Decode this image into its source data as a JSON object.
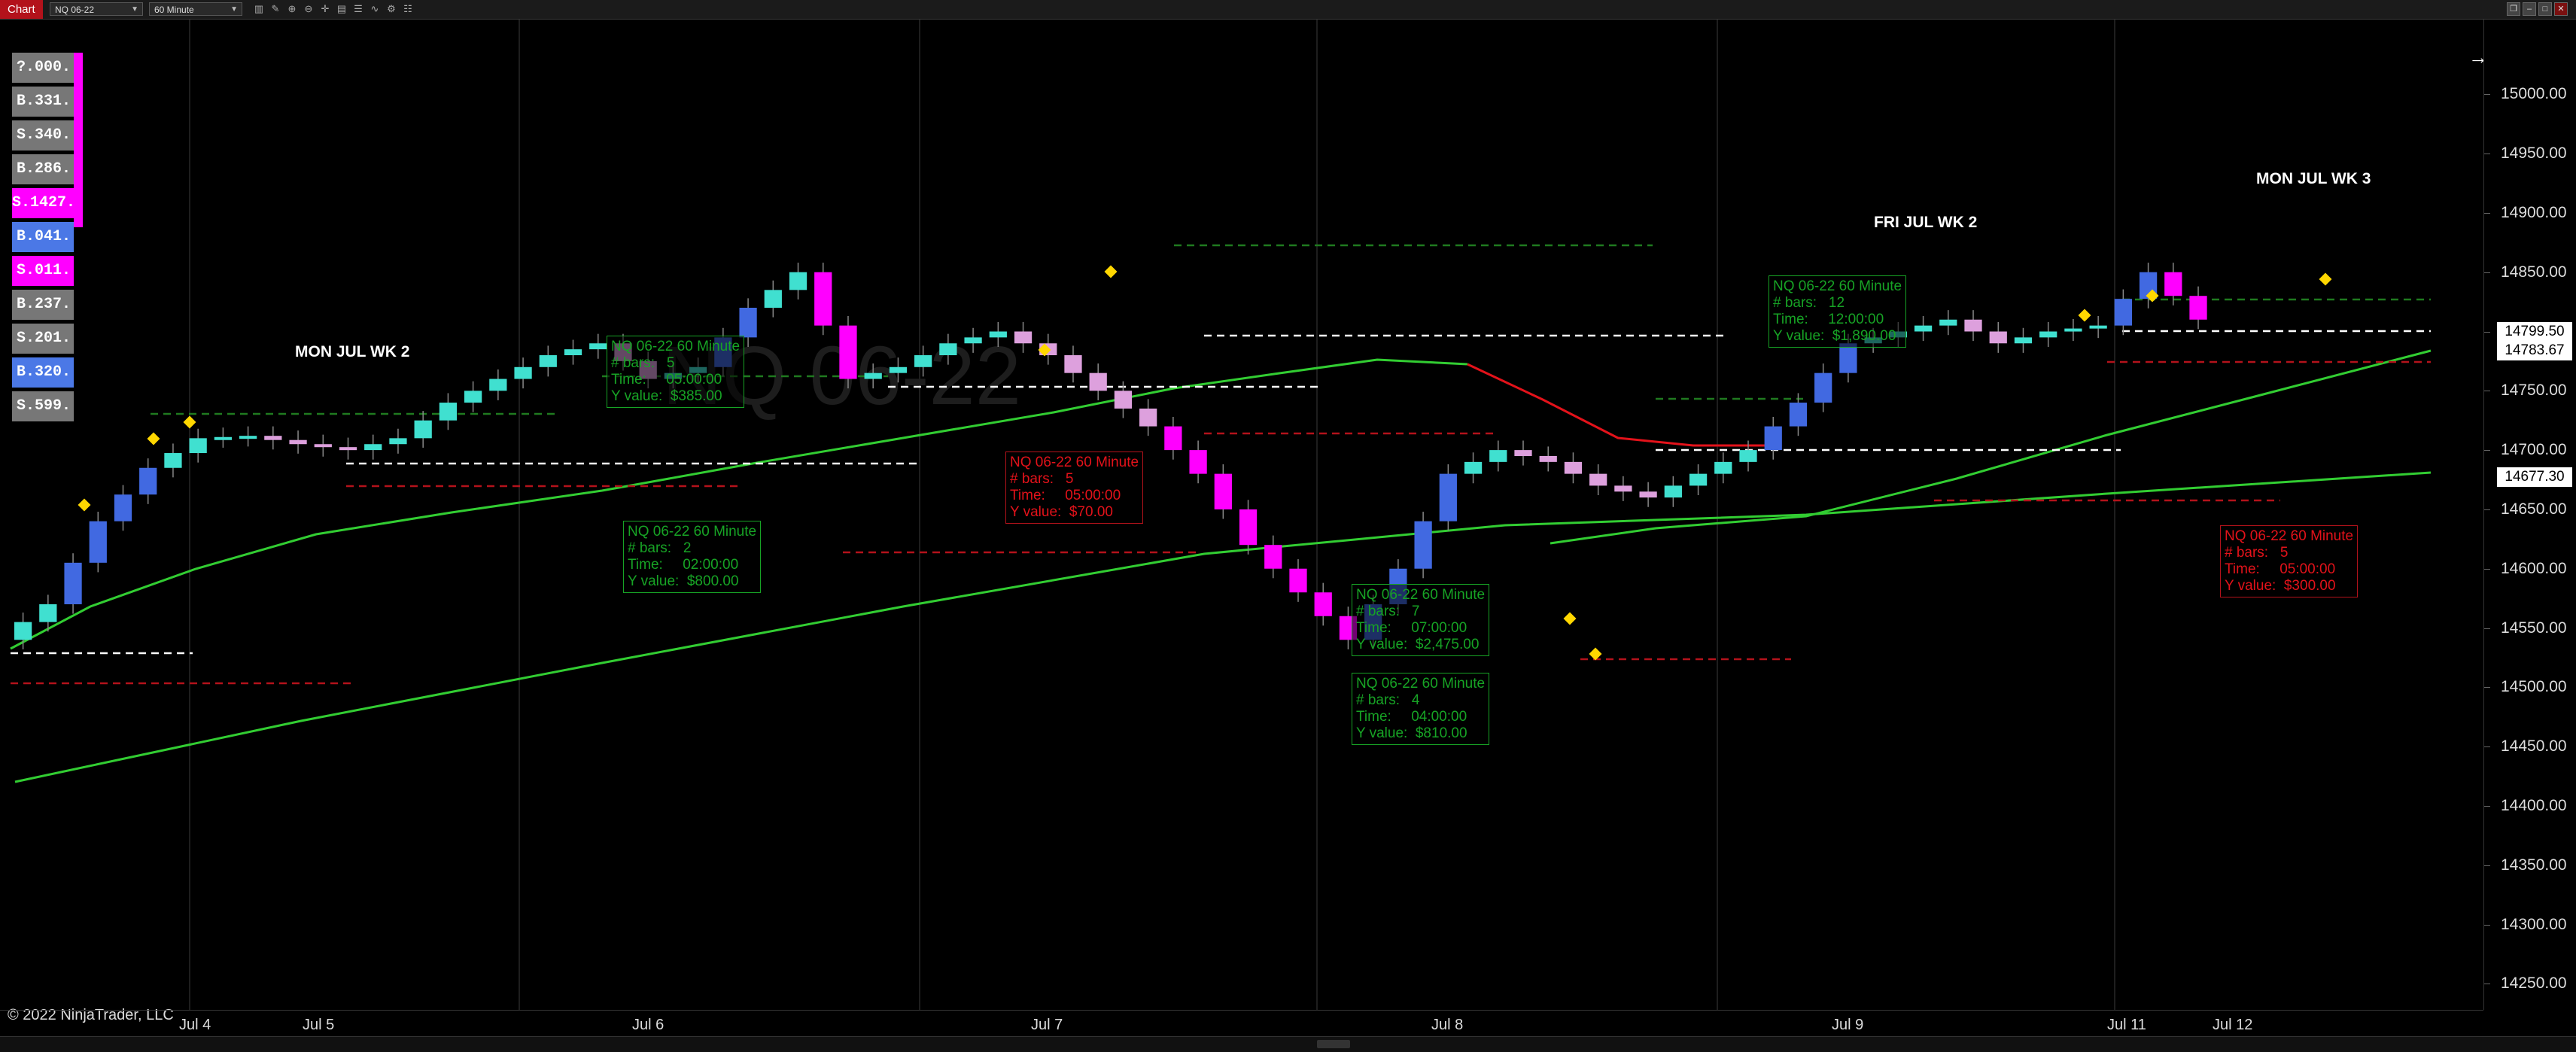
{
  "toolbar": {
    "tab_label": "Chart",
    "instrument": "NQ 06-22",
    "interval": "60 Minute",
    "icons": [
      "bar-type-icon",
      "pencil-icon",
      "zoom-in-icon",
      "zoom-out-icon",
      "crosshair-icon",
      "data-box-icon",
      "chart-properties-icon",
      "indicators-icon",
      "strategies-icon",
      "templates-icon"
    ],
    "window_buttons": [
      "restore",
      "minimize",
      "maximize",
      "close"
    ],
    "window_glyphs": [
      "❐",
      "‒",
      "□",
      "✕"
    ]
  },
  "chart": {
    "watermark": "NQ 06-22",
    "copyright": "© 2022 NinjaTrader, LLC",
    "session_labels": [
      {
        "text": "MON JUL WK 2"
      },
      {
        "text": "FRI JUL WK 2"
      },
      {
        "text": "MON JUL WK 3"
      }
    ],
    "order_tags": [
      {
        "text": "?.000.",
        "color": "#777777"
      },
      {
        "text": "B.331.",
        "color": "#777777"
      },
      {
        "text": "S.340.",
        "color": "#777777"
      },
      {
        "text": "B.286.",
        "color": "#777777"
      },
      {
        "text": "S.1427.",
        "color": "#ff00ff"
      },
      {
        "text": "B.041.",
        "color": "#4b78e6"
      },
      {
        "text": "S.011.",
        "color": "#ff00ff"
      },
      {
        "text": "B.237.",
        "color": "#777777"
      },
      {
        "text": "S.201.",
        "color": "#777777"
      },
      {
        "text": "B.320.",
        "color": "#4b78e6"
      },
      {
        "text": "S.599.",
        "color": "#777777"
      }
    ],
    "annotations": [
      {
        "title": "NQ 06-22 60 Minute",
        "bars": "5",
        "time": "05:00:00",
        "yvalue": "$385.00",
        "color": "green"
      },
      {
        "title": "NQ 06-22 60 Minute",
        "bars": "2",
        "time": "02:00:00",
        "yvalue": "$800.00",
        "color": "green"
      },
      {
        "title": "NQ 06-22 60 Minute",
        "bars": "5",
        "time": "05:00:00",
        "yvalue": "$70.00",
        "color": "red"
      },
      {
        "title": "NQ 06-22 60 Minute",
        "bars": "7",
        "time": "07:00:00",
        "yvalue": "$2,475.00",
        "color": "green"
      },
      {
        "title": "NQ 06-22 60 Minute",
        "bars": "4",
        "time": "04:00:00",
        "yvalue": "$810.00",
        "color": "green"
      },
      {
        "title": "NQ 06-22 60 Minute",
        "bars": "12",
        "time": "12:00:00",
        "yvalue": "$1,890.00",
        "color": "green"
      },
      {
        "title": "NQ 06-22 60 Minute",
        "bars": "5",
        "time": "05:00:00",
        "yvalue": "$300.00",
        "color": "red"
      }
    ],
    "annotation_labels": {
      "bars": "# bars:",
      "time": "Time:",
      "yvalue": "Y value:"
    },
    "price_flags": [
      {
        "text": "14799.50",
        "bg": "#ffffff",
        "fg": "#000000",
        "price": 14799.5
      },
      {
        "text": "14783.67",
        "bg": "#ffffff",
        "fg": "#000000",
        "price": 14783.67
      },
      {
        "text": "14677.30",
        "bg": "#ffffff",
        "fg": "#000000",
        "price": 14677.3
      }
    ],
    "colors": {
      "up_bar": "#4169e1",
      "down_bar": "#ff00ff",
      "up_small": "#40e0d0",
      "down_small": "#dda0dd",
      "ema_fast": "#32cd32",
      "ema_slow": "#32cd32",
      "ema_red": "#e3121a",
      "signal": "#ffd700"
    }
  },
  "chart_data": {
    "type": "candlestick",
    "instrument": "NQ 06-22",
    "interval": "60 Minute",
    "y_ticks": [
      "15000.00",
      "14950.00",
      "14900.00",
      "14850.00",
      "14800.00",
      "14750.00",
      "14700.00",
      "14650.00",
      "14600.00",
      "14550.00",
      "14500.00",
      "14450.00",
      "14400.00",
      "14350.00",
      "14300.00",
      "14250.00"
    ],
    "ylim": [
      14228,
      15063
    ],
    "x_date_labels": [
      "Jul 4",
      "Jul 5",
      "Jul 6",
      "Jul 7",
      "Jul 8",
      "Jul 9",
      "Jul 11",
      "Jul 12"
    ],
    "session_close": [
      14570,
      14640,
      14685,
      14710,
      14712,
      14705,
      14700,
      14710,
      14740,
      14760,
      14780,
      14790,
      14760,
      14770,
      14820,
      14850,
      14760,
      14770,
      14790,
      14800,
      14780,
      14750,
      14720,
      14680,
      14620,
      14580,
      14540,
      14600,
      14680,
      14700,
      14690,
      14670,
      14660,
      14680,
      14700,
      14740,
      14790,
      14800,
      14810,
      14790,
      14800,
      14805,
      14850,
      14810
    ]
  }
}
